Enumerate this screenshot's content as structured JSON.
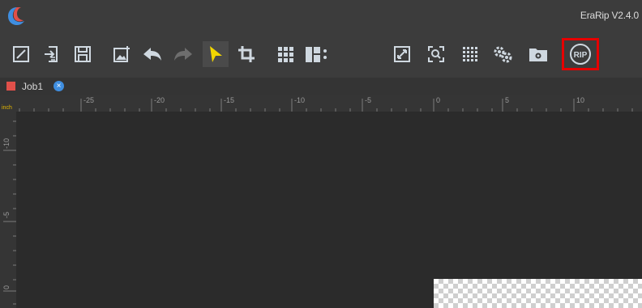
{
  "window": {
    "app_title": "EraRip V2.4.0"
  },
  "toolbar": {
    "rip_label": "RIP"
  },
  "tabs": [
    {
      "label": "Job1"
    }
  ],
  "ruler": {
    "unit": "inch",
    "horizontal_ticks": [
      "-25",
      "-20",
      "-15",
      "-10",
      "-5",
      "0",
      "5",
      "10"
    ],
    "vertical_ticks": [
      "-10",
      "-5",
      "0"
    ]
  },
  "colors": {
    "background": "#2b2b2b",
    "panel": "#3c3c3c",
    "accent_yellow": "#f2d600",
    "icon": "#cfd8e0",
    "highlight_red": "#e60000",
    "tab_red": "#e0504a",
    "tab_close_blue": "#3f8ee0"
  }
}
